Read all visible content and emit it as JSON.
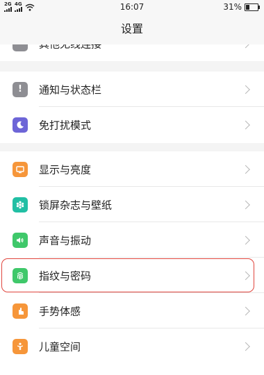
{
  "status_bar": {
    "signal_labels": [
      "2G",
      "4G"
    ],
    "time": "16:07",
    "battery_percent": "31%",
    "battery_level": 0.31
  },
  "header": {
    "title": "设置"
  },
  "colors": {
    "gray": "#8e8e93",
    "purple": "#6d65d7",
    "orange": "#f6963a",
    "teal": "#21bfa4",
    "green": "#3fc86a",
    "highlight": "#e0443c"
  },
  "items": [
    {
      "label": "其他无线连接",
      "icon": "wireless-icon"
    },
    {
      "label": "通知与状态栏",
      "icon": "notification-icon"
    },
    {
      "label": "免打扰模式",
      "icon": "moon-icon"
    },
    {
      "label": "显示与亮度",
      "icon": "display-icon"
    },
    {
      "label": "锁屏杂志与壁纸",
      "icon": "wallpaper-icon"
    },
    {
      "label": "声音与振动",
      "icon": "sound-icon"
    },
    {
      "label": "指纹与密码",
      "icon": "fingerprint-icon"
    },
    {
      "label": "手势体感",
      "icon": "gesture-icon"
    },
    {
      "label": "儿童空间",
      "icon": "child-icon"
    }
  ]
}
